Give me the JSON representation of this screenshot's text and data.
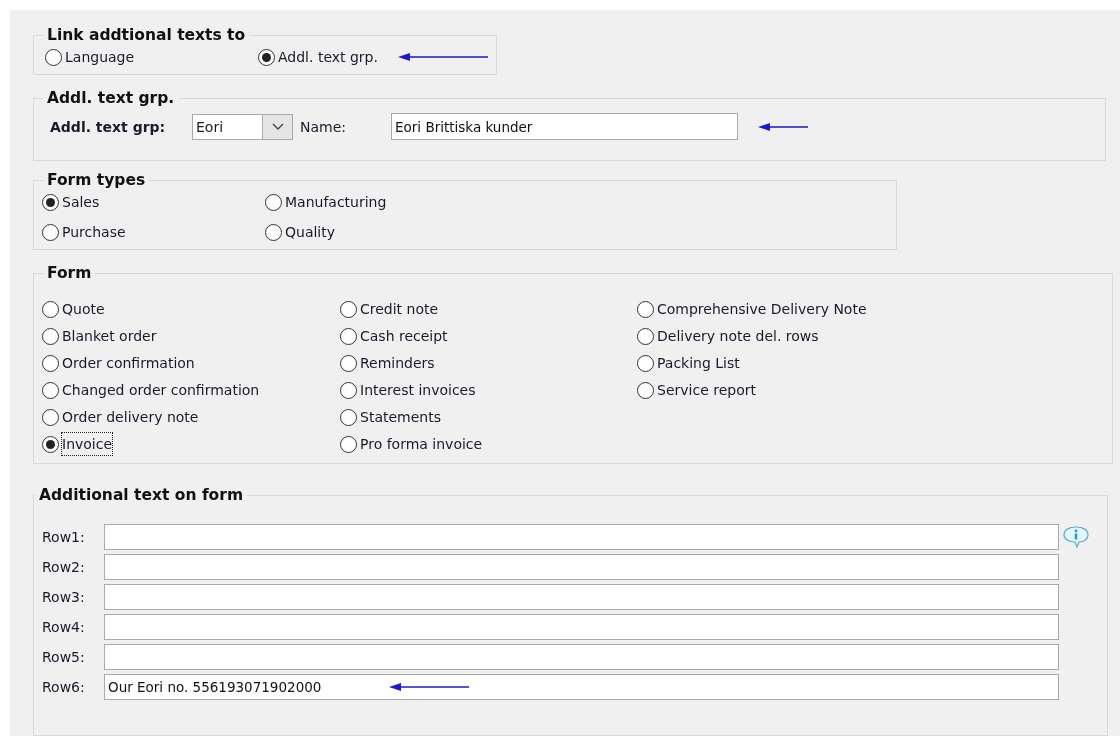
{
  "link_group": {
    "title": "Link addtional texts to",
    "options": [
      {
        "label": "Language",
        "selected": false,
        "pointer_arrow": false
      },
      {
        "label": "Addl. text grp.",
        "selected": true,
        "pointer_arrow": true
      }
    ]
  },
  "text_group": {
    "title": "Addl. text grp.",
    "combo_label": "Addl. text grp:",
    "combo_value": "Eori",
    "name_label": "Name:",
    "name_value": "Eori Brittiska kunder",
    "pointer_arrow": true
  },
  "form_types": {
    "title": "Form types",
    "options": [
      {
        "label": "Sales",
        "selected": true
      },
      {
        "label": "Manufacturing",
        "selected": false
      },
      {
        "label": "Purchase",
        "selected": false
      },
      {
        "label": "Quality",
        "selected": false
      }
    ]
  },
  "form": {
    "title": "Form",
    "columns": [
      [
        {
          "label": "Quote",
          "selected": false,
          "focused": false
        },
        {
          "label": "Blanket order",
          "selected": false,
          "focused": false
        },
        {
          "label": "Order confirmation",
          "selected": false,
          "focused": false
        },
        {
          "label": "Changed order confirmation",
          "selected": false,
          "focused": false
        },
        {
          "label": "Order delivery note",
          "selected": false,
          "focused": false
        },
        {
          "label": "Invoice",
          "selected": true,
          "focused": true
        }
      ],
      [
        {
          "label": "Credit note",
          "selected": false,
          "focused": false
        },
        {
          "label": "Cash receipt",
          "selected": false,
          "focused": false
        },
        {
          "label": "Reminders",
          "selected": false,
          "focused": false
        },
        {
          "label": "Interest invoices",
          "selected": false,
          "focused": false
        },
        {
          "label": "Statements",
          "selected": false,
          "focused": false
        },
        {
          "label": "Pro forma invoice",
          "selected": false,
          "focused": false
        }
      ],
      [
        {
          "label": "Comprehensive Delivery Note",
          "selected": false,
          "focused": false
        },
        {
          "label": "Delivery note del. rows",
          "selected": false,
          "focused": false
        },
        {
          "label": "Packing List",
          "selected": false,
          "focused": false
        },
        {
          "label": "Service report",
          "selected": false,
          "focused": false
        }
      ]
    ]
  },
  "additional_text": {
    "title": "Additional text on form",
    "rows": [
      {
        "label": "Row1:",
        "value": "",
        "info": true,
        "pointer_arrow": false
      },
      {
        "label": "Row2:",
        "value": "",
        "info": false,
        "pointer_arrow": false
      },
      {
        "label": "Row3:",
        "value": "",
        "info": false,
        "pointer_arrow": false
      },
      {
        "label": "Row4:",
        "value": "",
        "info": false,
        "pointer_arrow": false
      },
      {
        "label": "Row5:",
        "value": "",
        "info": false,
        "pointer_arrow": false
      },
      {
        "label": "Row6:",
        "value": "Our Eori no. 556193071902000",
        "info": false,
        "pointer_arrow": true
      }
    ]
  }
}
